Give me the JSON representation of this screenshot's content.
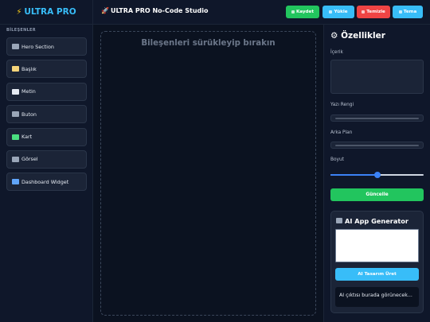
{
  "app": {
    "logo_icon": "lightning-icon",
    "logo_text": "ULTRA PRO",
    "title_icon": "rocket-icon",
    "title": "ULTRA PRO No-Code Studio"
  },
  "sidebar": {
    "section_title": "BİLEŞENLER",
    "items": [
      {
        "label": "Hero Section",
        "icon": "image-icon",
        "icon_color": "#9aa6b8"
      },
      {
        "label": "Başlık",
        "icon": "memo-icon",
        "icon_color": "#f5d47a"
      },
      {
        "label": "Metin",
        "icon": "page-icon",
        "icon_color": "#e6ebf3"
      },
      {
        "label": "Buton",
        "icon": "radio-button-icon",
        "icon_color": "#9aa6b8"
      },
      {
        "label": "Kart",
        "icon": "puzzle-icon",
        "icon_color": "#4ade80"
      },
      {
        "label": "Görsel",
        "icon": "image-icon",
        "icon_color": "#9aa6b8"
      },
      {
        "label": "Dashboard Widget",
        "icon": "chart-icon",
        "icon_color": "#60a5fa"
      }
    ]
  },
  "toolbar": {
    "buttons": [
      {
        "label": "Kaydet",
        "icon": "save-icon",
        "color": "#22c55e"
      },
      {
        "label": "Yükle",
        "icon": "folder-icon",
        "color": "#38bdf8"
      },
      {
        "label": "Temizle",
        "icon": "trash-icon",
        "color": "#ef4444"
      },
      {
        "label": "Tema",
        "icon": "moon-icon",
        "color": "#38bdf8"
      }
    ]
  },
  "canvas": {
    "placeholder": "Bileşenleri sürükleyip bırakın"
  },
  "properties": {
    "title_icon": "gear-icon",
    "title": "Özellikler",
    "content_label": "İçerik",
    "content_value": "",
    "text_color_label": "Yazı Rengi",
    "text_color_value": "#4b5567",
    "bg_label": "Arka Plan",
    "bg_value": "#4b5567",
    "size_label": "Boyut",
    "size_fraction": 0.5,
    "update_label": "Güncelle",
    "accent": "#3b82f6"
  },
  "ai": {
    "title_icon": "robot-icon",
    "title": "AI App Generator",
    "prompt_value": "",
    "button_label": "AI Tasarım Üret",
    "output": "AI çıktısı burada görünecek..."
  }
}
